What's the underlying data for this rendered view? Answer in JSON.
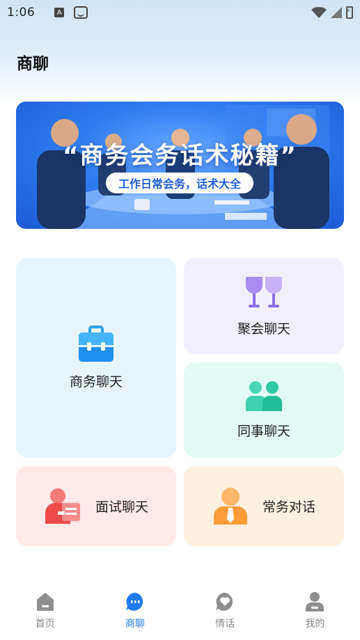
{
  "status": {
    "time": "1:06",
    "a_icon": "A"
  },
  "header": {
    "title": "商聊"
  },
  "banner": {
    "title": "“商务会务话术秘籍”",
    "subtitle": "工作日常会务，话术大全"
  },
  "cards": {
    "business": {
      "label": "商务聊天",
      "icon": "briefcase-icon"
    },
    "party": {
      "label": "聚会聊天",
      "icon": "wine-glasses-icon"
    },
    "colleague": {
      "label": "同事聊天",
      "icon": "two-people-icon"
    },
    "interview": {
      "label": "面试聊天",
      "icon": "interview-person-icon"
    },
    "routine": {
      "label": "常务对话",
      "icon": "person-tie-icon"
    }
  },
  "tabbar": {
    "items": [
      {
        "label": "首页",
        "icon": "home-icon"
      },
      {
        "label": "商聊",
        "icon": "chat-bubble-icon"
      },
      {
        "label": "情话",
        "icon": "heart-bubble-icon"
      },
      {
        "label": "我的",
        "icon": "user-icon"
      }
    ],
    "active_index": 1
  },
  "colors": {
    "accent": "#1f7cf0",
    "inactive": "#8a8a8a"
  }
}
